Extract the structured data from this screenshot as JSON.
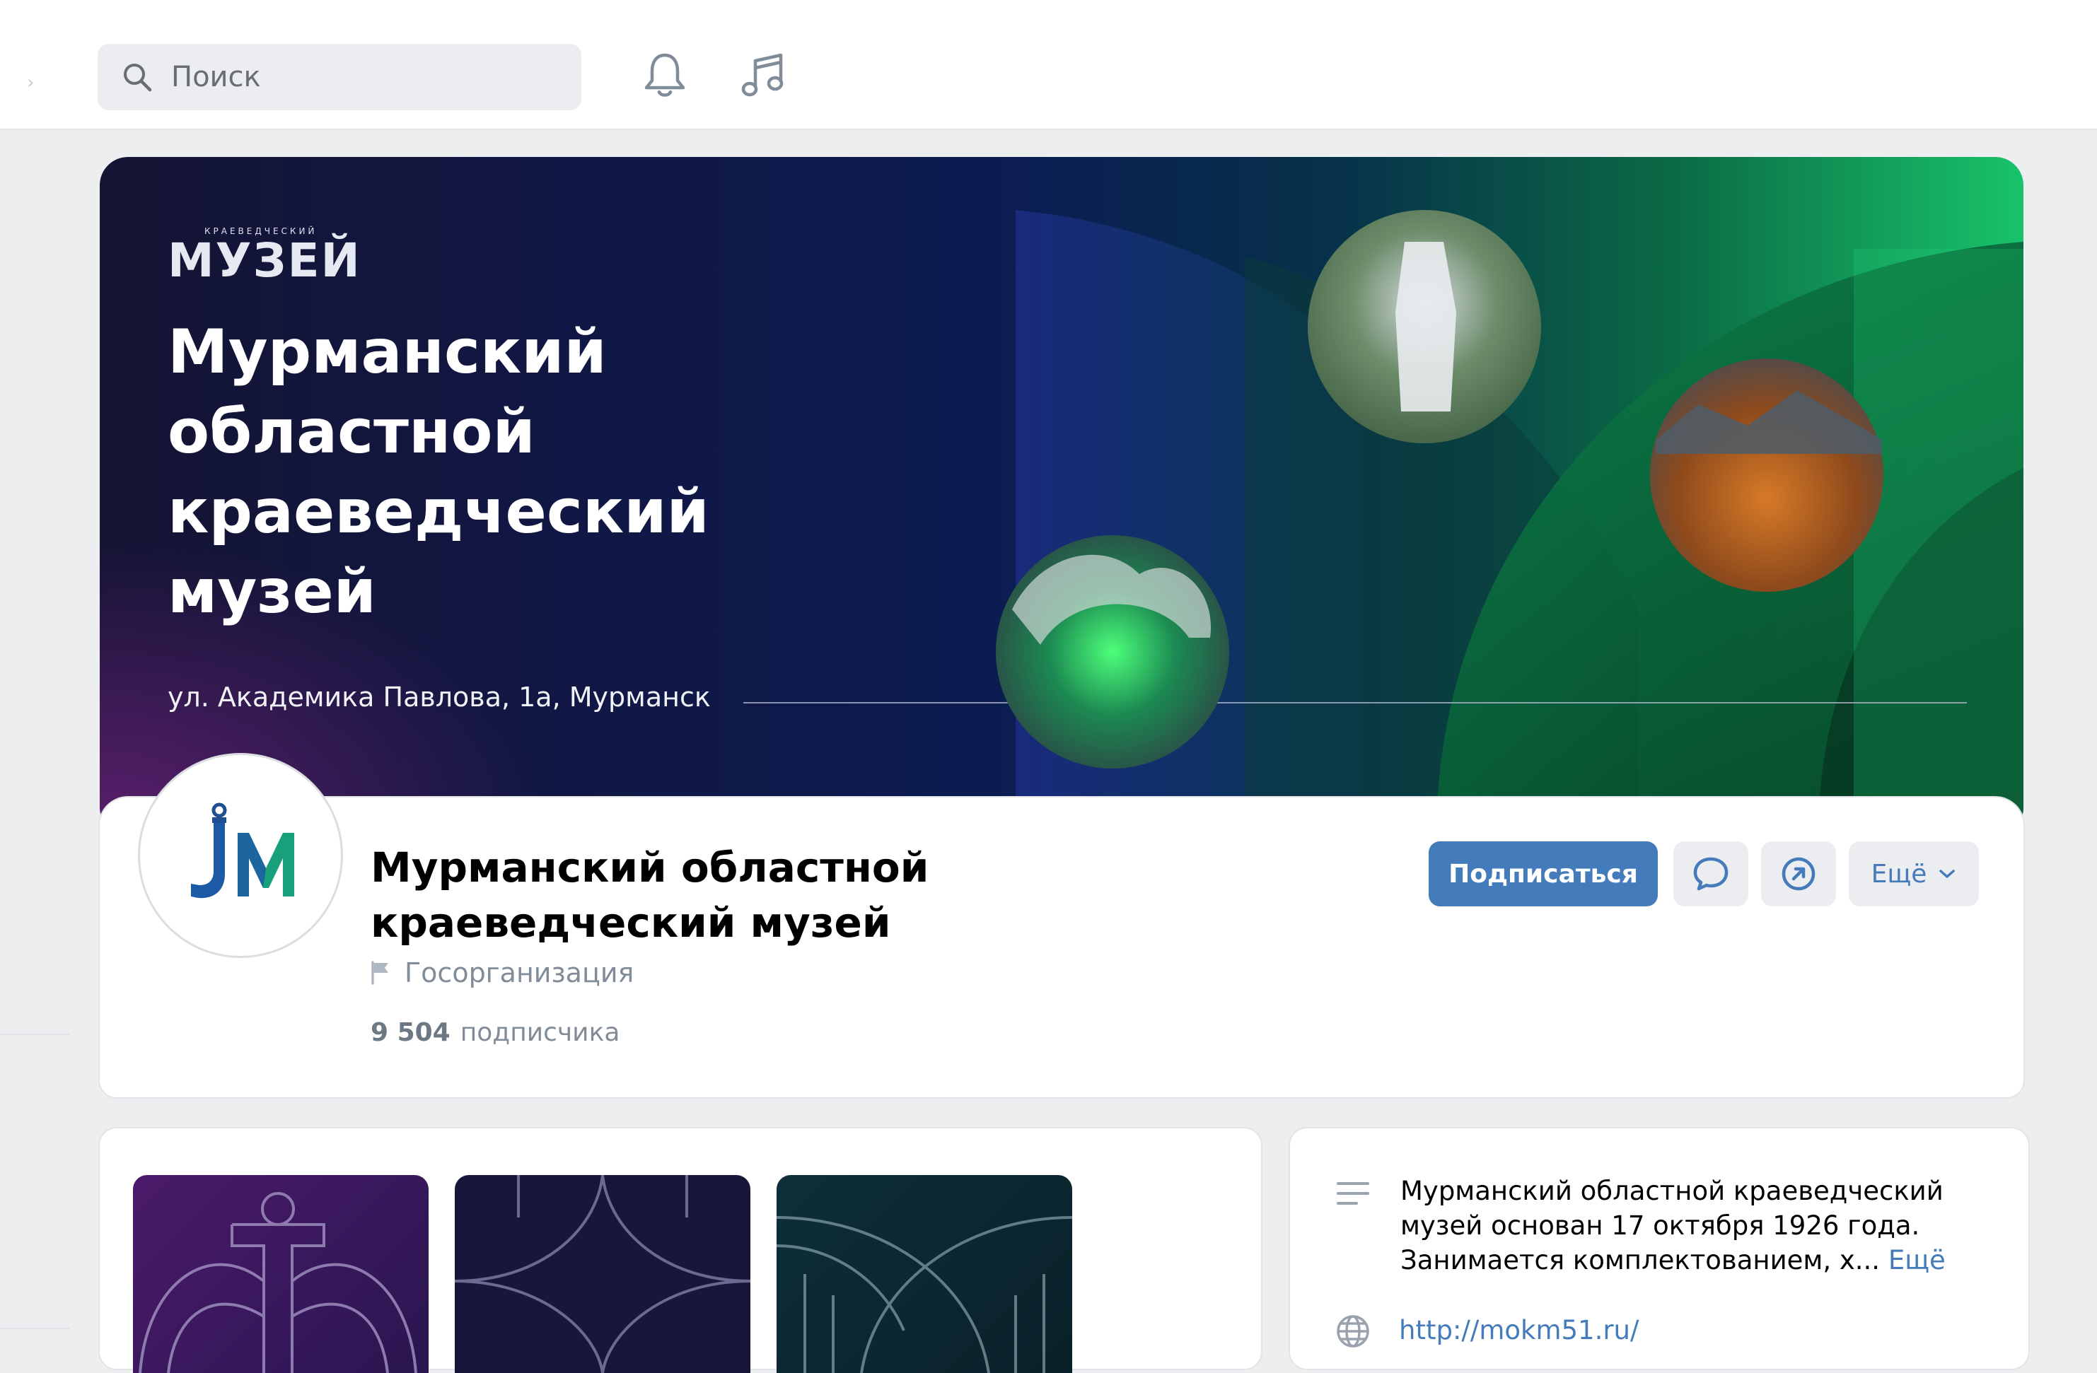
{
  "header": {
    "search_placeholder": "Поиск",
    "icons": [
      "search-icon",
      "bell-icon",
      "music-icon"
    ]
  },
  "cover": {
    "logo_small": "КРАЕВЕДЧЕСКИЙ",
    "logo_word": "МУЗЕЙ",
    "title_lines": [
      "Мурманский",
      "областной",
      "краеведческий",
      "музей"
    ],
    "address": "ул. Академика Павлова, 1а, Мурманск"
  },
  "profile": {
    "name": "Мурманский областной краеведческий музей",
    "category": "Госорганизация",
    "subscribers_count": "9 504",
    "subscribers_label": "подписчика",
    "subscribe_label": "Подписаться",
    "more_label": "Ещё",
    "accent_color": "#447bba"
  },
  "about": {
    "text": "Мурманский областной краеведческий музей основан 17 октября 1926 года. Занимается комплектованием, х...",
    "more_label": "Ещё",
    "link": "http://mokm51.ru/"
  }
}
